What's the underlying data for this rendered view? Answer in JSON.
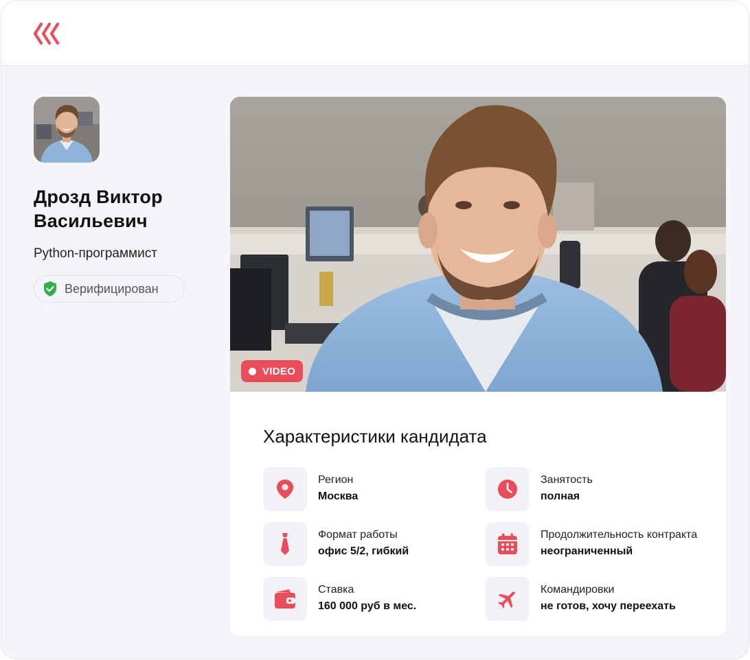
{
  "header": {
    "logo_icon": "triple-chevron-left-icon"
  },
  "profile": {
    "name": "Дрозд Виктор Васильевич",
    "position": "Python-программист",
    "badge": "Верифицирован",
    "badge_icon": "shield-check-icon"
  },
  "media": {
    "badge": "VIDEO"
  },
  "characteristics": {
    "title": "Характеристики кандидата",
    "items": [
      {
        "icon": "location-pin-icon",
        "label": "Регион",
        "value": "Москва"
      },
      {
        "icon": "clock-icon",
        "label": "Занятость",
        "value": "полная"
      },
      {
        "icon": "tie-icon",
        "label": "Формат работы",
        "value": "офис 5/2, гибкий"
      },
      {
        "icon": "calendar-icon",
        "label": "Продолжительность контракта",
        "value": "неограниченный"
      },
      {
        "icon": "wallet-icon",
        "label": "Ставка",
        "value": "160 000 руб в мес."
      },
      {
        "icon": "airplane-icon",
        "label": "Командировки",
        "value": "не готов, хочу переехать"
      }
    ]
  },
  "colors": {
    "accent": "#ea4c5a",
    "verified": "#2eb04a",
    "background": "#f4f5f9"
  }
}
